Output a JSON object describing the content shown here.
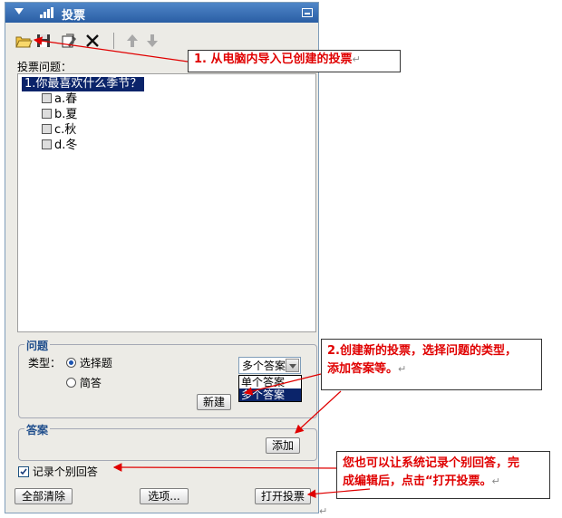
{
  "panel": {
    "title": "投票",
    "toolbar": [
      {
        "name": "open-folder-icon"
      },
      {
        "name": "save-icon"
      },
      {
        "name": "edit-vote-icon"
      },
      {
        "name": "delete-icon"
      },
      {
        "name": "move-up-icon"
      },
      {
        "name": "move-down-icon"
      }
    ],
    "question_label": "投票问题：",
    "question": "1.你最喜欢什么季节？",
    "options": [
      "a.春",
      "b.夏",
      "c.秋",
      "d.冬"
    ],
    "question_group": {
      "label": "问题",
      "type_label": "类型：",
      "radio_choice": "选择题",
      "radio_short": "简答",
      "selected_radio": "选择题",
      "dropdown_value": "多个答案",
      "dropdown_options": [
        "单个答案",
        "多个答案"
      ],
      "highlighted_option": "多个答案",
      "new_button": "新建"
    },
    "answer_group": {
      "label": "答案",
      "add_button": "添加"
    },
    "record_checkbox": "记录个别回答",
    "record_checked": true,
    "clear_button": "全部清除",
    "options_button": "选项...",
    "open_button": "打开投票"
  },
  "annotations": {
    "a1": "1. 从电脑内导入已创建的投票",
    "a2_line1": "2.创建新的投票，选择问题的类型，",
    "a2_line2": "添加答案等。",
    "a3_line1": "您也可以让系统记录个别回答，完",
    "a3_line2": "成编辑后，点击“打开投票。",
    "return_mark": "↵"
  },
  "colors": {
    "accent": "#2a5ea4",
    "annotation_text": "#e00000",
    "arrow": "#e00000",
    "selection": "#0b246a"
  }
}
